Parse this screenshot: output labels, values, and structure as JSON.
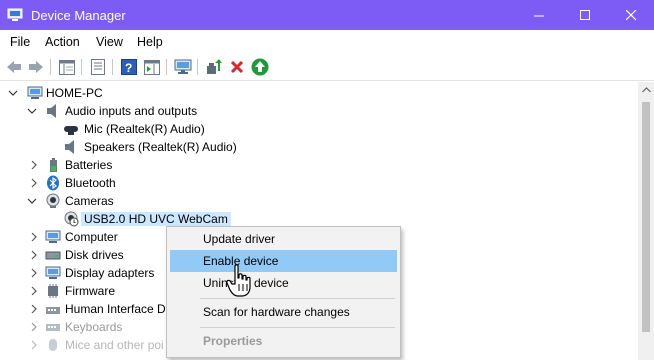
{
  "window": {
    "title": "Device Manager"
  },
  "menubar": {
    "items": [
      "File",
      "Action",
      "View",
      "Help"
    ]
  },
  "toolbar": {
    "buttons": [
      "back-icon",
      "forward-icon",
      "show-hide-console-tree-icon",
      "properties-icon",
      "help-icon",
      "show-action-pane-icon",
      "monitor-icon",
      "update-driver-icon",
      "uninstall-x-icon",
      "enable-device-icon"
    ]
  },
  "tree": {
    "root": "HOME-PC",
    "items": [
      {
        "label": "Audio inputs and outputs",
        "expanded": true,
        "children": [
          "Mic (Realtek(R) Audio)",
          "Speakers (Realtek(R) Audio)"
        ]
      },
      {
        "label": "Batteries"
      },
      {
        "label": "Bluetooth"
      },
      {
        "label": "Cameras",
        "expanded": true,
        "children": [
          "USB2.0 HD UVC WebCam"
        ]
      },
      {
        "label": "Computer"
      },
      {
        "label": "Disk drives"
      },
      {
        "label": "Display adapters"
      },
      {
        "label": "Firmware"
      },
      {
        "label": "Human Interface De"
      },
      {
        "label": "Keyboards"
      },
      {
        "label": "Mice and other poi"
      }
    ]
  },
  "context_menu": {
    "items": [
      "Update driver",
      "Enable device",
      "Uninst",
      "device",
      "Scan for hardware changes",
      "Properties"
    ],
    "highlighted": "Enable device"
  },
  "colors": {
    "titlebar": "#7c5cf5",
    "highlight": "#91c9f7",
    "selection": "#cce8ff"
  }
}
